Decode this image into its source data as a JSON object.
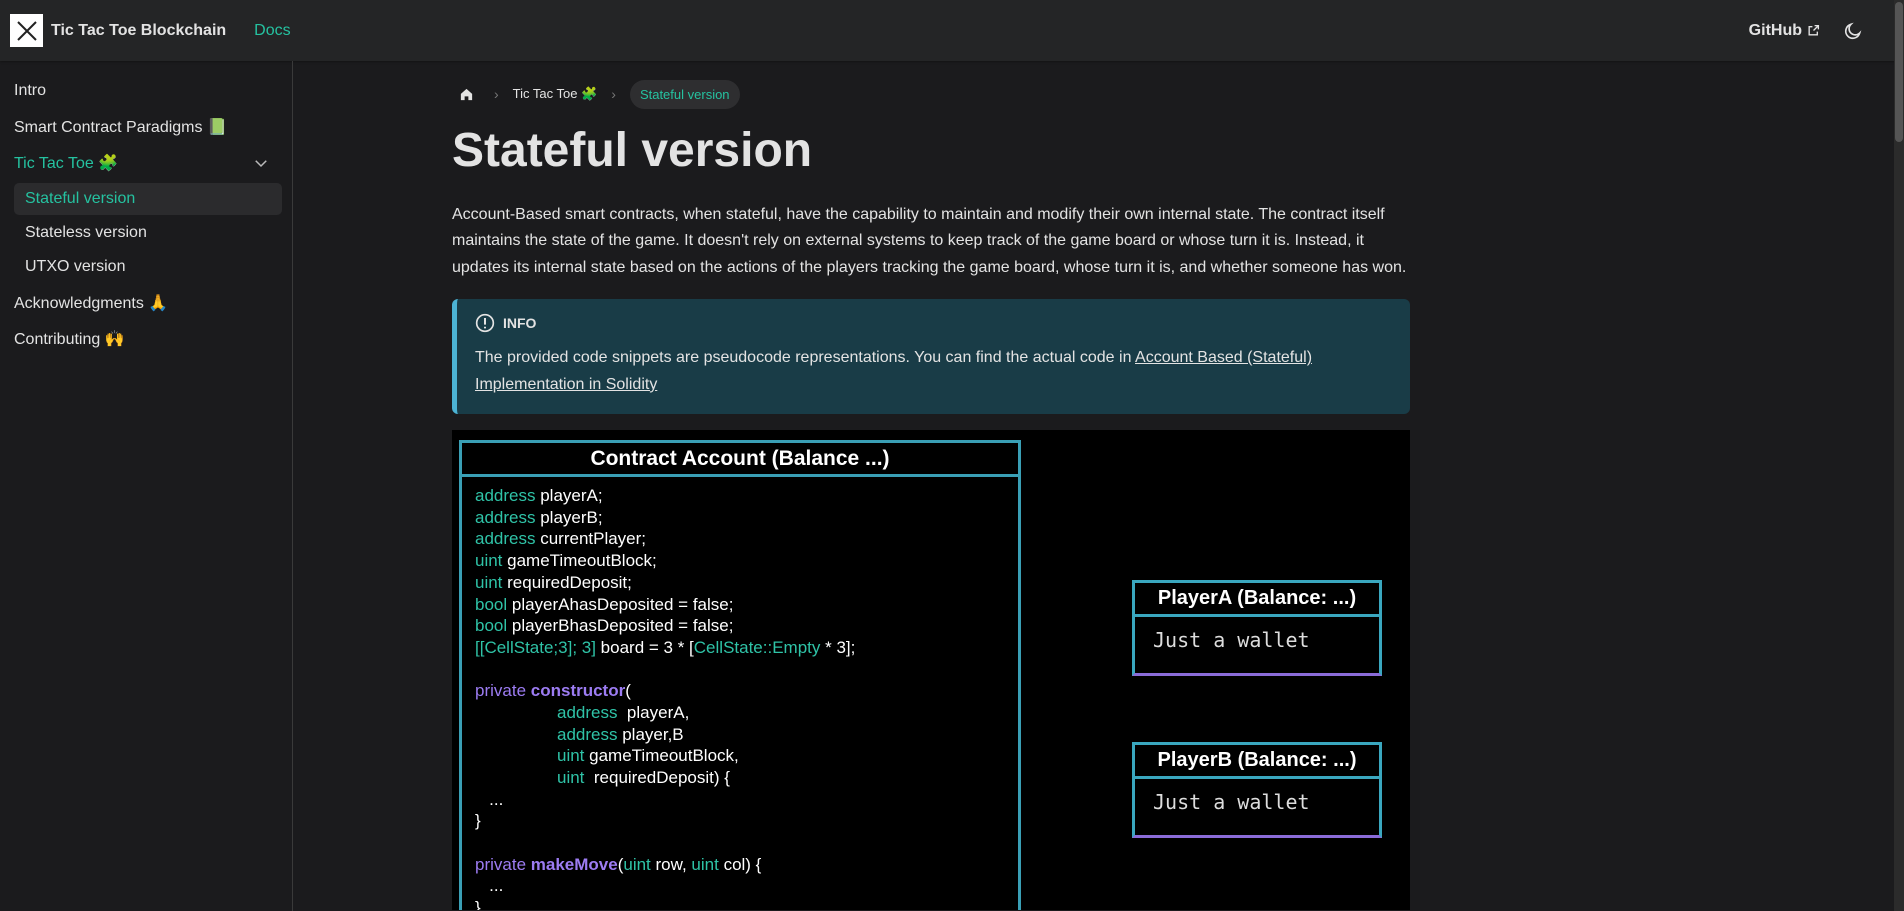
{
  "navbar": {
    "brand": "Tic Tac Toe Blockchain",
    "docs": "Docs",
    "github": "GitHub"
  },
  "sidebar": {
    "items": [
      {
        "label": "Intro"
      },
      {
        "label": "Smart Contract Paradigms 📗"
      },
      {
        "label": "Tic Tac Toe 🧩"
      },
      {
        "label": "Acknowledgments 🙏"
      },
      {
        "label": "Contributing 🙌"
      }
    ],
    "sub_items": [
      {
        "label": "Stateful version"
      },
      {
        "label": "Stateless version"
      },
      {
        "label": "UTXO version"
      }
    ]
  },
  "breadcrumbs": {
    "item1": "Tic Tac Toe 🧩",
    "current": "Stateful version"
  },
  "page": {
    "title": "Stateful version",
    "intro": "Account-Based smart contracts, when stateful, have the capability to maintain and modify their own internal state. The contract itself maintains the state of the game. It doesn't rely on external systems to keep track of the game board or whose turn it is. Instead, it updates its internal state based on the actions of the players tracking the game board, whose turn it is, and whether someone has won."
  },
  "admonition": {
    "title": "INFO",
    "text": "The provided code snippets are pseudocode representations. You can find the actual code in ",
    "link": "Account Based (Stateful) Implementation in Solidity"
  },
  "diagram": {
    "contract_title": "Contract Account (Balance ...)",
    "playerA_title": "PlayerA (Balance: ...)",
    "playerA_body": "Just a wallet",
    "playerB_title": "PlayerB (Balance: ...)",
    "playerB_body": "Just a wallet",
    "code": {
      "l1_kw": "address",
      "l1_rest": " playerA;",
      "l2_kw": "address",
      "l2_rest": " playerB;",
      "l3_kw": "address",
      "l3_rest": " currentPlayer;",
      "l4_kw": "uint",
      "l4_rest": " gameTimeoutBlock;",
      "l5_kw": "uint",
      "l5_rest": " requiredDeposit;",
      "l6_kw": "bool",
      "l6_rest": " playerAhasDeposited = false;",
      "l7_kw": "bool",
      "l7_rest": " playerBhasDeposited = false;",
      "l8_a": "[[CellState;3]; 3]",
      "l8_b": " board = 3 * [",
      "l8_c": "CellState::Empty",
      "l8_d": " * 3];",
      "l10_kw": "private",
      "l10_fn": "constructor",
      "l10_rest": "(",
      "l11_kw": "address",
      "l11_rest": "  playerA,",
      "l12_kw": "address",
      "l12_rest": " player,B",
      "l13_kw": "uint",
      "l13_rest": " gameTimeoutBlock,",
      "l14_kw": "uint",
      "l14_rest": "  requiredDeposit) {",
      "l15": "   ...",
      "l16": "}",
      "l18_kw": "private",
      "l18_fn": "makeMove",
      "l18_a": "(",
      "l18_kw2": "uint",
      "l18_b": " row, ",
      "l18_kw3": "uint",
      "l18_c": " col) {",
      "l19": "   ...",
      "l20": "}"
    }
  }
}
